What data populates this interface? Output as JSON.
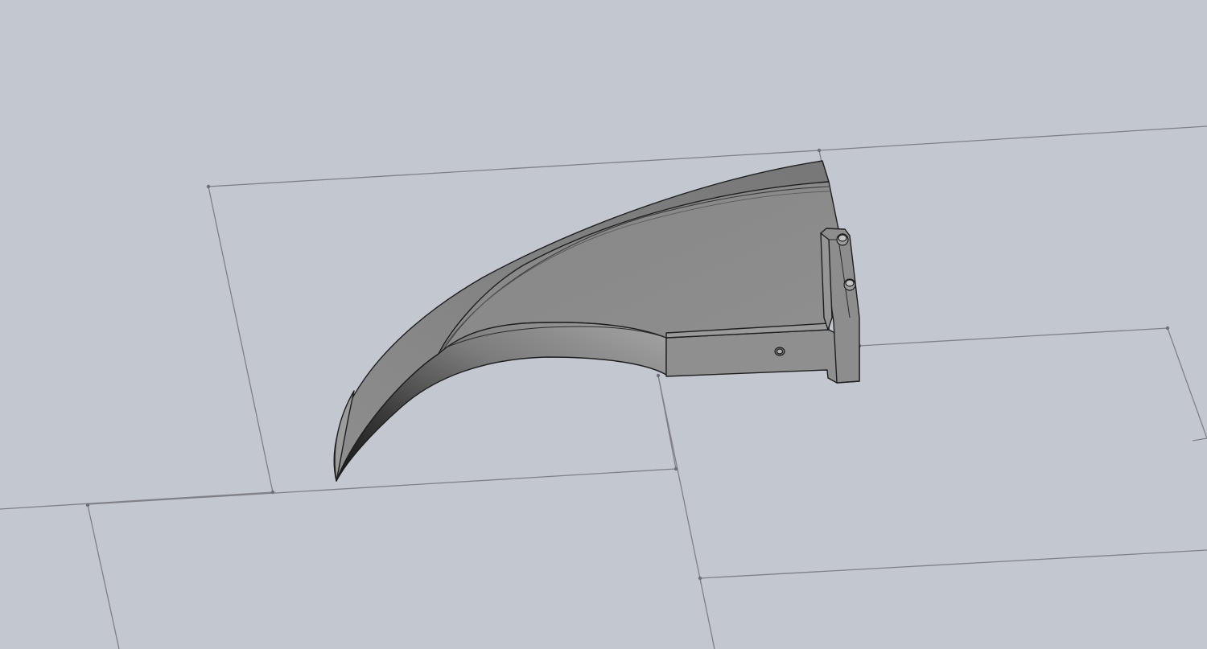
{
  "viewport": {
    "background_color": "#c3c7d0",
    "grid_line_color": "#7f8186",
    "model_edge_color": "#1e1e1e"
  },
  "model": {
    "body_color": "#8f8f8f",
    "top_face_color": "#8a8a8a",
    "dark_shadow_color": "#161616",
    "light_face_color": "#9a9a9a"
  }
}
